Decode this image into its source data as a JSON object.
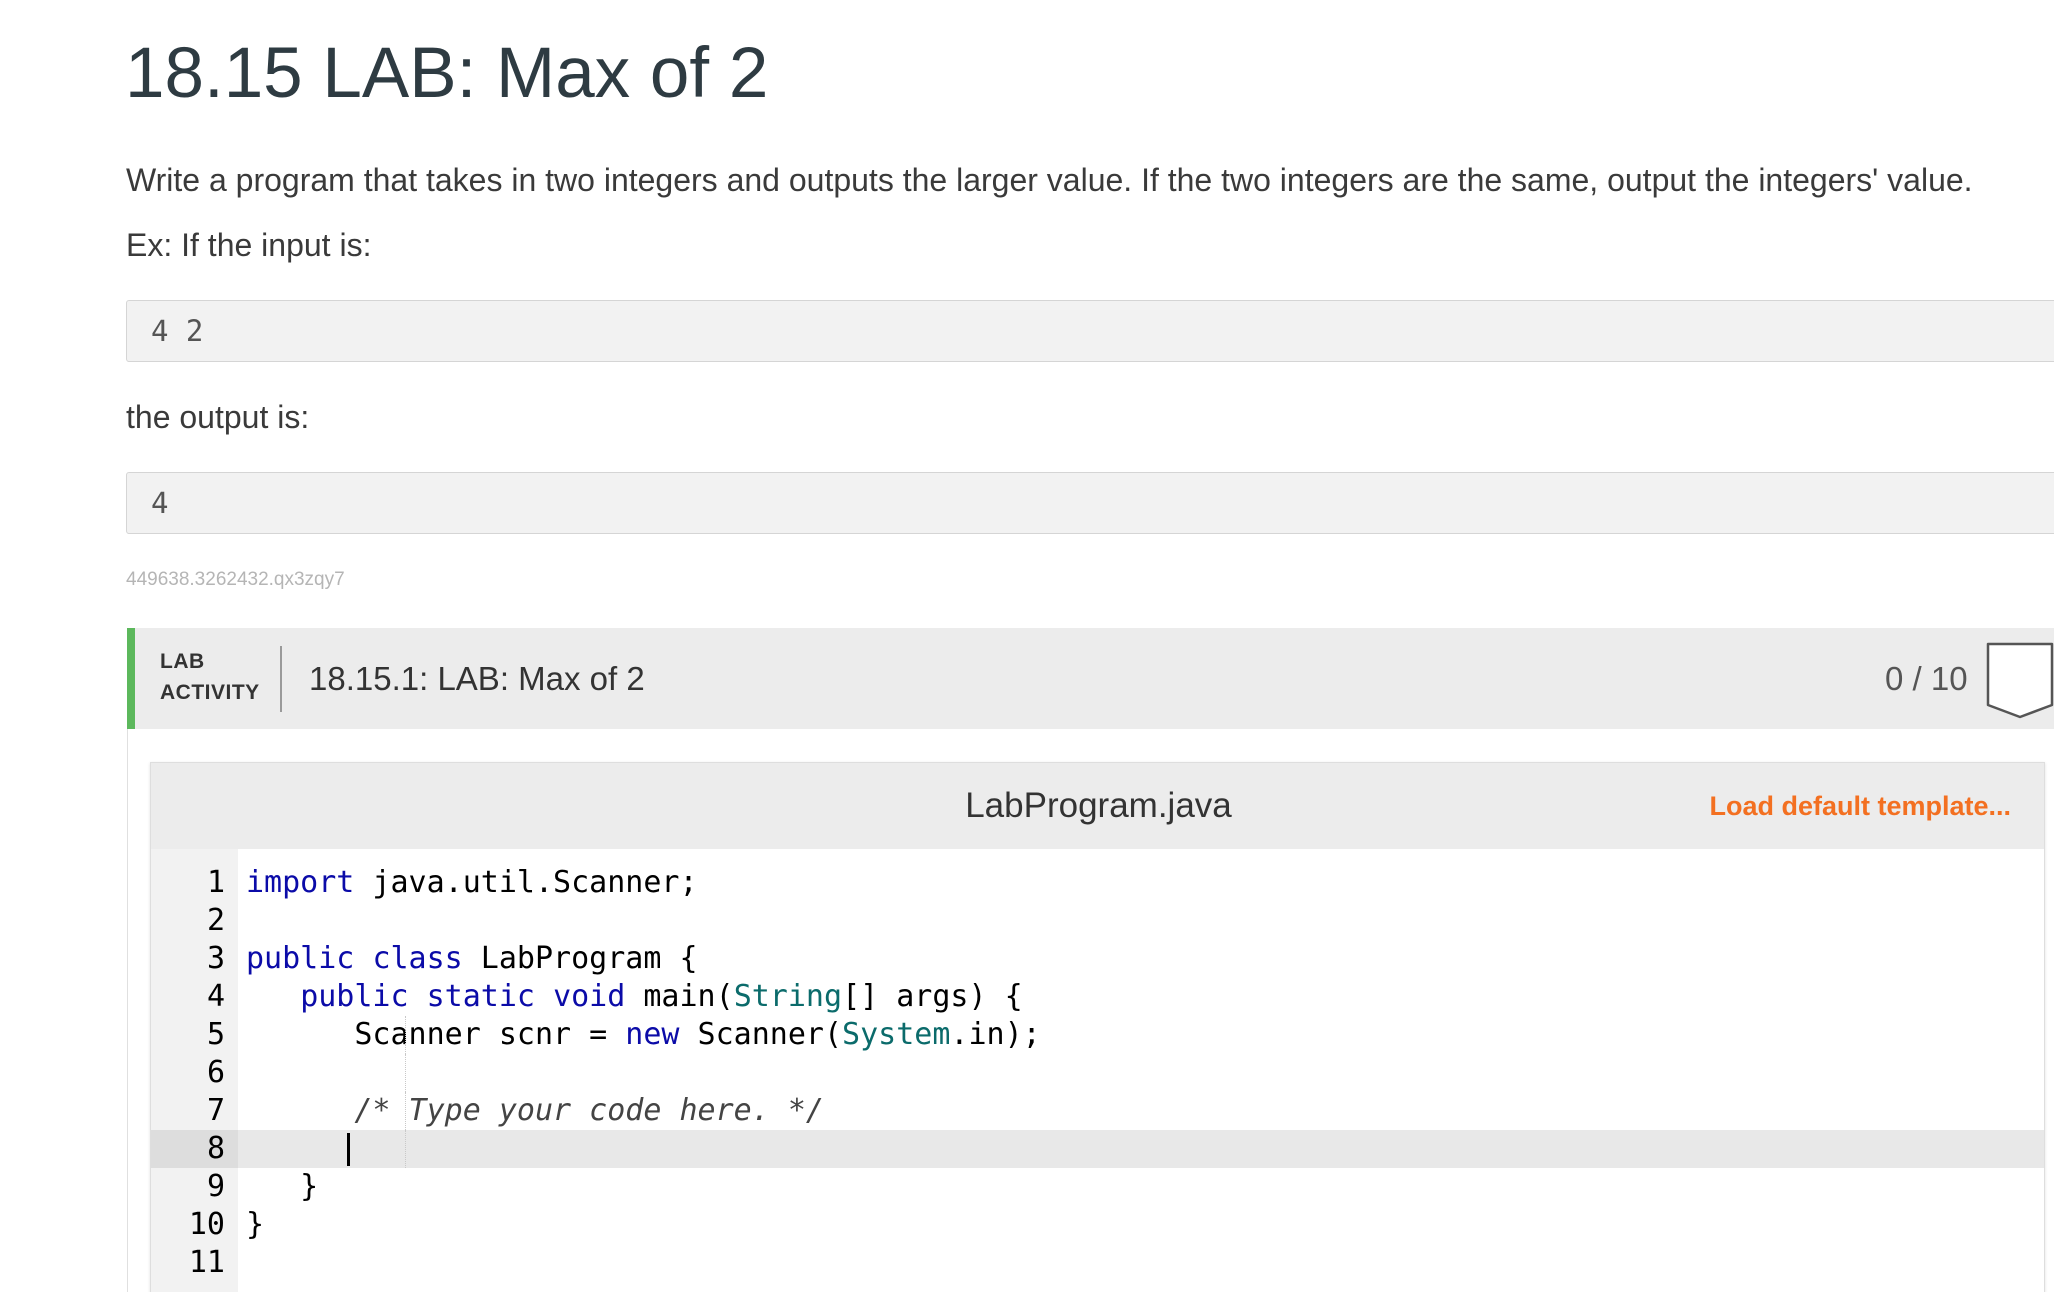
{
  "page": {
    "title": "18.15 LAB: Max of 2",
    "description": "Write a program that takes in two integers and outputs the larger value. If the two integers are the same, output the integers' value.",
    "example_input_label": "Ex: If the input is:",
    "example_input": "4 2",
    "example_output_label": "the output is:",
    "example_output": "4",
    "zybook_id": "449638.3262432.qx3zqy7"
  },
  "lab": {
    "tag_line1": "LAB",
    "tag_line2": "ACTIVITY",
    "title": "18.15.1: LAB: Max of 2",
    "score": "0 / 10",
    "accent_color": "#5cb85c"
  },
  "editor": {
    "filename": "LabProgram.java",
    "load_template_label": "Load default template...",
    "load_template_color": "#f37021",
    "active_line": 8,
    "lines": [
      {
        "n": "1",
        "tokens": [
          [
            "kw",
            "import"
          ],
          [
            "",
            " java.util.Scanner;"
          ]
        ]
      },
      {
        "n": "2",
        "tokens": []
      },
      {
        "n": "3",
        "tokens": [
          [
            "kw",
            "public"
          ],
          [
            "",
            " "
          ],
          [
            "kw",
            "class"
          ],
          [
            "",
            " LabProgram {"
          ]
        ]
      },
      {
        "n": "4",
        "tokens": [
          [
            "",
            "   "
          ],
          [
            "kw",
            "public"
          ],
          [
            "",
            " "
          ],
          [
            "kw",
            "static"
          ],
          [
            "",
            " "
          ],
          [
            "kw",
            "void"
          ],
          [
            "",
            " main("
          ],
          [
            "ty",
            "String"
          ],
          [
            "",
            "[] args) {"
          ]
        ]
      },
      {
        "n": "5",
        "tokens": [
          [
            "",
            "      Scanner scnr = "
          ],
          [
            "kw",
            "new"
          ],
          [
            "",
            " Scanner("
          ],
          [
            "ty",
            "System"
          ],
          [
            "",
            ".in);"
          ]
        ]
      },
      {
        "n": "6",
        "tokens": []
      },
      {
        "n": "7",
        "tokens": [
          [
            "",
            "      "
          ],
          [
            "cm",
            "/* Type your code here. */"
          ]
        ]
      },
      {
        "n": "8",
        "tokens": []
      },
      {
        "n": "9",
        "tokens": [
          [
            "",
            "   }"
          ]
        ]
      },
      {
        "n": "10",
        "tokens": [
          [
            "",
            "}"
          ]
        ]
      },
      {
        "n": "11",
        "tokens": []
      }
    ]
  }
}
